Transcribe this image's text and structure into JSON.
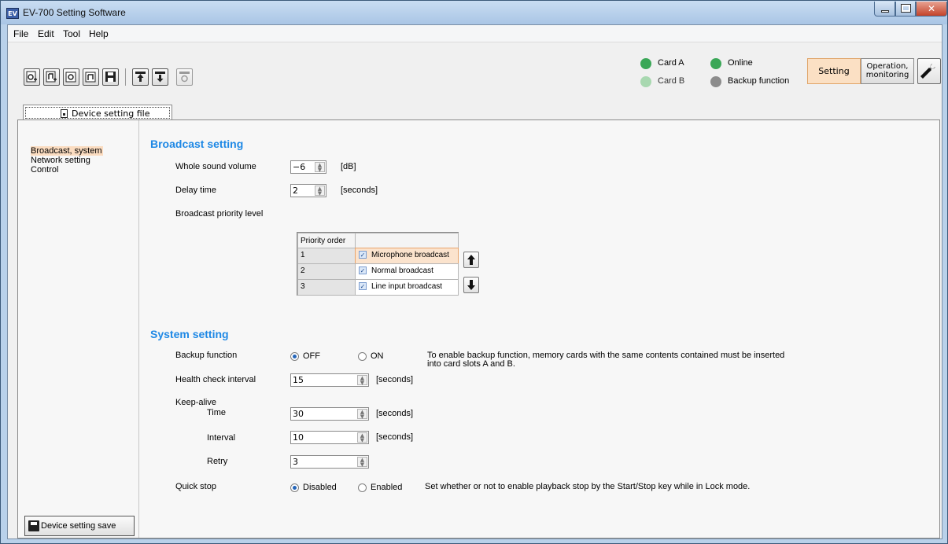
{
  "window": {
    "title": "EV-700 Setting Software",
    "app_icon": "EV"
  },
  "menu": [
    "File",
    "Edit",
    "Tool",
    "Help"
  ],
  "status": {
    "card_a": "Card A",
    "card_b": "Card B",
    "online": "Online",
    "backup": "Backup function",
    "colors": {
      "active": "#3aa757",
      "inactive": "#a8d8b0",
      "off": "#8c8c8c"
    }
  },
  "mode": {
    "setting": "Setting",
    "operation_line1": "Operation,",
    "operation_line2": "monitoring"
  },
  "tab": {
    "label": "Device setting file"
  },
  "sidebar": {
    "items": [
      "Broadcast, system",
      "Network setting",
      "Control"
    ],
    "save_button": "Device setting save"
  },
  "broadcast": {
    "title": "Broadcast setting",
    "volume": {
      "label": "Whole sound volume",
      "value": "−6",
      "unit": "[dB]"
    },
    "delay": {
      "label": "Delay time",
      "value": "2",
      "unit": "[seconds]"
    },
    "priority": {
      "label": "Broadcast priority level",
      "header": "Priority order",
      "rows": [
        {
          "order": "1",
          "name": "Microphone broadcast",
          "checked": true
        },
        {
          "order": "2",
          "name": "Normal broadcast",
          "checked": true
        },
        {
          "order": "3",
          "name": "Line input broadcast",
          "checked": true
        }
      ]
    }
  },
  "system": {
    "title": "System setting",
    "backup": {
      "label": "Backup function",
      "off": "OFF",
      "on": "ON",
      "selected": "OFF",
      "note_line1": "To enable backup function, memory cards with the same contents contained must be inserted",
      "note_line2": "into card slots A and B."
    },
    "health": {
      "label": "Health check interval",
      "value": "15",
      "unit": "[seconds]"
    },
    "keepalive": {
      "label": "Keep-alive",
      "time": {
        "label": "Time",
        "value": "30",
        "unit": "[seconds]"
      },
      "interval": {
        "label": "Interval",
        "value": "10",
        "unit": "[seconds]"
      },
      "retry": {
        "label": "Retry",
        "value": "3"
      }
    },
    "quickstop": {
      "label": "Quick stop",
      "disabled": "Disabled",
      "enabled": "Enabled",
      "selected": "Disabled",
      "note": "Set whether or not to enable playback stop by the Start/Stop key while in Lock mode."
    }
  }
}
